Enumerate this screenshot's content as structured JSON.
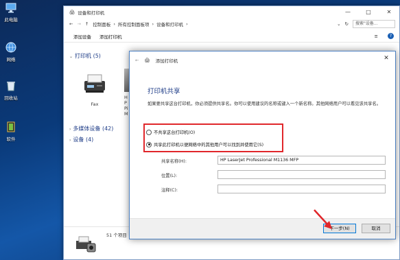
{
  "desktop": {
    "icons": [
      {
        "label": "此电脑",
        "icon": "this-pc-icon"
      },
      {
        "label": "网络",
        "icon": "network-icon"
      },
      {
        "label": "回收站",
        "icon": "recycle-bin-icon"
      },
      {
        "label": "软件",
        "icon": "folder-icon"
      }
    ]
  },
  "explorer": {
    "title": "设备和打印机",
    "window_buttons": {
      "minimize": "—",
      "maximize": "□",
      "close": "✕"
    },
    "nav": {
      "back": "←",
      "forward": "→",
      "up": "↑",
      "breadcrumb": [
        "控制面板",
        "所有控制面板项",
        "设备和打印机"
      ],
      "refresh": "↻",
      "search_placeholder": "搜索\"设备...",
      "search_icon": "search-icon"
    },
    "toolbar": {
      "add_device": "添加设备",
      "add_printer": "添加打印机",
      "view_menu": "≡",
      "help": "?"
    },
    "groups": {
      "printers": "打印机 (5)",
      "multimedia": "多媒体设备 (42)",
      "devices": "设备 (4)"
    },
    "fax_label": "Fax",
    "printer2_label_partial": "H\nP\nPi\nM",
    "status_count": "51 个项目"
  },
  "dialog": {
    "back": "←",
    "title": "添加打印机",
    "close": "✕",
    "heading": "打印机共享",
    "description": "如果要共享这台打印机，你必须提供共享名。你可以使用建议的名称或键入一个新名称。其他网络用户可以看见该共享名。",
    "radio_no_share": "不共享这台打印机(O)",
    "radio_share": "共享此打印机以便网络中的其他用户可以找到并使用它(S)",
    "share_name_label": "共享名称(H):",
    "share_name_value": "HP LaserJet Professional M1136 MFP",
    "location_label": "位置(L):",
    "location_value": "",
    "comment_label": "注释(C):",
    "comment_value": "",
    "next_button": "下一步(N)",
    "cancel_button": "取消"
  },
  "colors": {
    "highlight_red": "#e0262a",
    "link_blue": "#1e3c87",
    "accent": "#0078d7"
  }
}
